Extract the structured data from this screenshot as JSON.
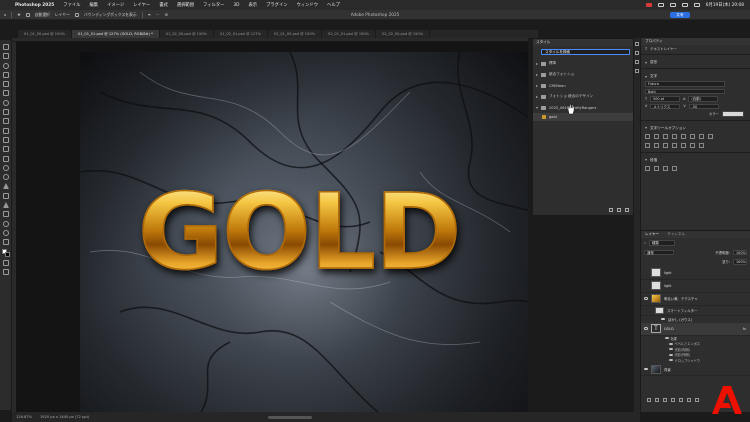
{
  "menubar": {
    "app_name": "Photoshop 2025",
    "items": [
      "ファイル",
      "編集",
      "イメージ",
      "レイヤー",
      "書式",
      "選択範囲",
      "フィルター",
      "3D",
      "表示",
      "プラグイン",
      "ウィンドウ",
      "ヘルプ"
    ],
    "clock": "6月19日(木) 20:08"
  },
  "optionsbar": {
    "auto_select_label": "自動選択",
    "layer_select": "レイヤー",
    "transform_label": "バウンディングボックスを表示",
    "window_title": "Adobe Photoshop 2025",
    "share_label": "共有"
  },
  "tabs": [
    {
      "label": "01_01_00.psd @ 150%",
      "active": false
    },
    {
      "label": "01_01_01.psd @ 127% (GOLD, RGB/8#) *",
      "active": true
    },
    {
      "label": "01_02_00.psd @ 150%",
      "active": false
    },
    {
      "label": "01_02_01.psd @ 127%",
      "active": false
    },
    {
      "label": "02_01_00.psd @ 150%",
      "active": false
    },
    {
      "label": "02_01_01.psd @ 150%",
      "active": false
    },
    {
      "label": "02_02_00.psd @ 150%",
      "active": false
    }
  ],
  "canvas": {
    "text": "GOLD"
  },
  "styles_panel": {
    "title": "スタイル",
    "search_value": "スタイルを検索",
    "folders": [
      {
        "label": "標準",
        "open": false
      },
      {
        "label": "統合フォトショ",
        "open": false
      },
      {
        "label": "CRENeon",
        "open": false
      },
      {
        "label": "フォトショ 統合のデザイン",
        "open": false
      },
      {
        "label": "2025_0616_FireflyRangers",
        "open": true
      }
    ],
    "selected_item": "gold"
  },
  "properties": {
    "title": "プロパティ",
    "layer_type": "テキストレイヤー",
    "transform_label": "変形",
    "character_label": "文字",
    "font_family": "Futura",
    "font_style": "Bold",
    "font_size": "500 pt",
    "leading": "(自動)",
    "kerning": "メトリクス",
    "tracking": "-50",
    "color_label": "カラー",
    "paragraph_label": "文字ツールオプション",
    "align_label": "段落"
  },
  "layers_panel": {
    "tabs": [
      "レイヤー",
      "チャンネル"
    ],
    "kind_filter": "種類",
    "blend_mode": "通常",
    "opacity_label": "不透明度:",
    "opacity_value": "100%",
    "fill_label": "塗り:",
    "fill_value": "100%",
    "layers": [
      {
        "name": "light",
        "thumb": "light"
      },
      {
        "name": "light",
        "thumb": "light"
      },
      {
        "name": "明るい黄、テクスチャ",
        "thumb": "gold"
      },
      {
        "name": "スマートフィルター",
        "thumb": "light"
      },
      {
        "name": "ぼかし (ガウス)",
        "thumb": ""
      },
      {
        "name": "GOLD",
        "thumb": "text"
      }
    ],
    "effects_label": "効果",
    "effects": [
      "ベベルとエンボス",
      "光彩(内側)",
      "光彩(外側)",
      "ドロップシャドウ"
    ],
    "background_name": "背景"
  },
  "statusbar": {
    "zoom": "126.87%",
    "doc_size": "1920 px x 1440 px (72 ppi)"
  }
}
